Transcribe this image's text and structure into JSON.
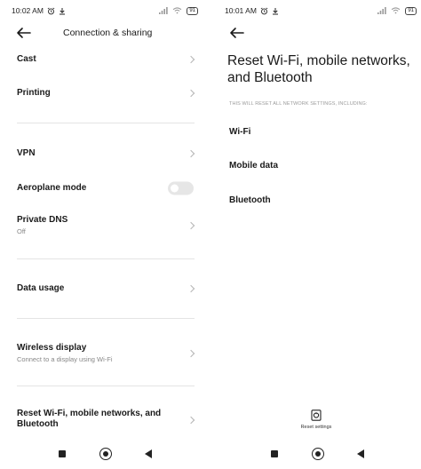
{
  "left_screen": {
    "status": {
      "time": "10:02 AM",
      "battery": "91"
    },
    "title": "Connection & sharing",
    "rows": {
      "cast": "Cast",
      "printing": "Printing",
      "vpn": "VPN",
      "aeroplane_mode": "Aeroplane mode",
      "aeroplane_mode_on": false,
      "private_dns": "Private DNS",
      "private_dns_value": "Off",
      "data_usage": "Data usage",
      "wireless_display": "Wireless display",
      "wireless_display_sub": "Connect to a display using Wi-Fi",
      "reset": "Reset Wi-Fi, mobile networks, and Bluetooth"
    }
  },
  "right_screen": {
    "status": {
      "time": "10:01 AM",
      "battery": "91"
    },
    "title": "Reset Wi-Fi, mobile networks, and Bluetooth",
    "caption": "THIS WILL RESET ALL NETWORK SETTINGS, INCLUDING:",
    "items": [
      "Wi-Fi",
      "Mobile data",
      "Bluetooth"
    ],
    "reset_button_label": "Reset settings"
  },
  "icons": [
    "alarm-icon",
    "download-icon",
    "signal-icon",
    "wifi-icon",
    "battery-icon",
    "back-arrow-icon",
    "chevron-right-icon",
    "reset-settings-icon",
    "nav-recents-icon",
    "nav-home-icon",
    "nav-back-icon"
  ]
}
